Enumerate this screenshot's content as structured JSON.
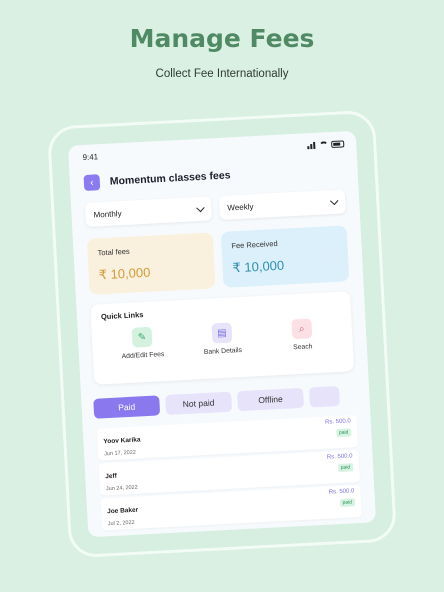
{
  "promo": {
    "headline": "Manage Fees",
    "subline": "Collect Fee Internationally"
  },
  "status": {
    "time": "9:41"
  },
  "header": {
    "back_icon": "chevron-left-icon",
    "title": "Momentum classes fees"
  },
  "filters": {
    "period": "Monthly",
    "frequency": "Weekly"
  },
  "summary": {
    "total_label": "Total fees",
    "total_value": "₹ 10,000",
    "received_label": "Fee Received",
    "received_value": "₹ 10,000",
    "colors": {
      "total": "#d59a3a",
      "received": "#2c8fb3"
    }
  },
  "quick_links": {
    "title": "Quick Links",
    "items": [
      {
        "label": "Add/Edit Fees",
        "icon": "pencil-icon"
      },
      {
        "label": "Bank Details",
        "icon": "document-icon"
      },
      {
        "label": "Seach",
        "icon": "search-icon"
      }
    ]
  },
  "tabs": [
    "Paid",
    "Not paid",
    "Offline"
  ],
  "payments": [
    {
      "name": "Yoov Karika",
      "date": "Jun 17, 2022",
      "amount": "Rs. 500.0",
      "status": "paid"
    },
    {
      "name": "Jeff",
      "date": "Jun 24, 2022",
      "amount": "Rs. 500.0",
      "status": "paid"
    },
    {
      "name": "Joe Baker",
      "date": "Jul 2, 2022",
      "amount": "Rs. 500.0",
      "status": "paid"
    }
  ],
  "accent": "#8a78ef"
}
